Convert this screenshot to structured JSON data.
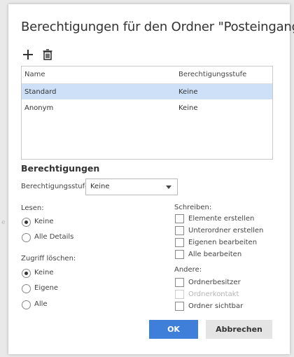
{
  "dialog": {
    "title": "Berechtigungen für den Ordner \"Posteingang\"",
    "toolbar": {
      "add_icon": "plus-icon",
      "delete_icon": "trash-icon"
    },
    "table": {
      "columns": [
        "Name",
        "Berechtigungsstufe"
      ],
      "rows": [
        {
          "name": "Standard",
          "level": "Keine",
          "selected": true
        },
        {
          "name": "Anonym",
          "level": "Keine",
          "selected": false
        }
      ]
    },
    "permissions": {
      "title": "Berechtigungen",
      "level_label": "Berechtigungsstufe:",
      "level_value": "Keine"
    },
    "read": {
      "label": "Lesen:",
      "options": [
        {
          "label": "Keine",
          "checked": true
        },
        {
          "label": "Alle Details",
          "checked": false
        }
      ]
    },
    "delete": {
      "label": "Zugriff löschen:",
      "options": [
        {
          "label": "Keine",
          "checked": true
        },
        {
          "label": "Eigene",
          "checked": false
        },
        {
          "label": "Alle",
          "checked": false
        }
      ]
    },
    "write": {
      "label": "Schreiben:",
      "options": [
        {
          "label": "Elemente erstellen",
          "checked": false
        },
        {
          "label": "Unterordner erstellen",
          "checked": false
        },
        {
          "label": "Eigenen bearbeiten",
          "checked": false
        },
        {
          "label": "Alle bearbeiten",
          "checked": false
        }
      ]
    },
    "other": {
      "label": "Andere:",
      "options": [
        {
          "label": "Ordnerbesitzer",
          "checked": false,
          "disabled": false
        },
        {
          "label": "Ordnerkontakt",
          "checked": false,
          "disabled": true
        },
        {
          "label": "Ordner sichtbar",
          "checked": false,
          "disabled": false
        }
      ]
    },
    "buttons": {
      "ok": "OK",
      "cancel": "Abbrechen"
    }
  },
  "background": {
    "side_mark": "e"
  },
  "colors": {
    "accent": "#3f7fd9",
    "selected_row": "#cde0f7"
  }
}
